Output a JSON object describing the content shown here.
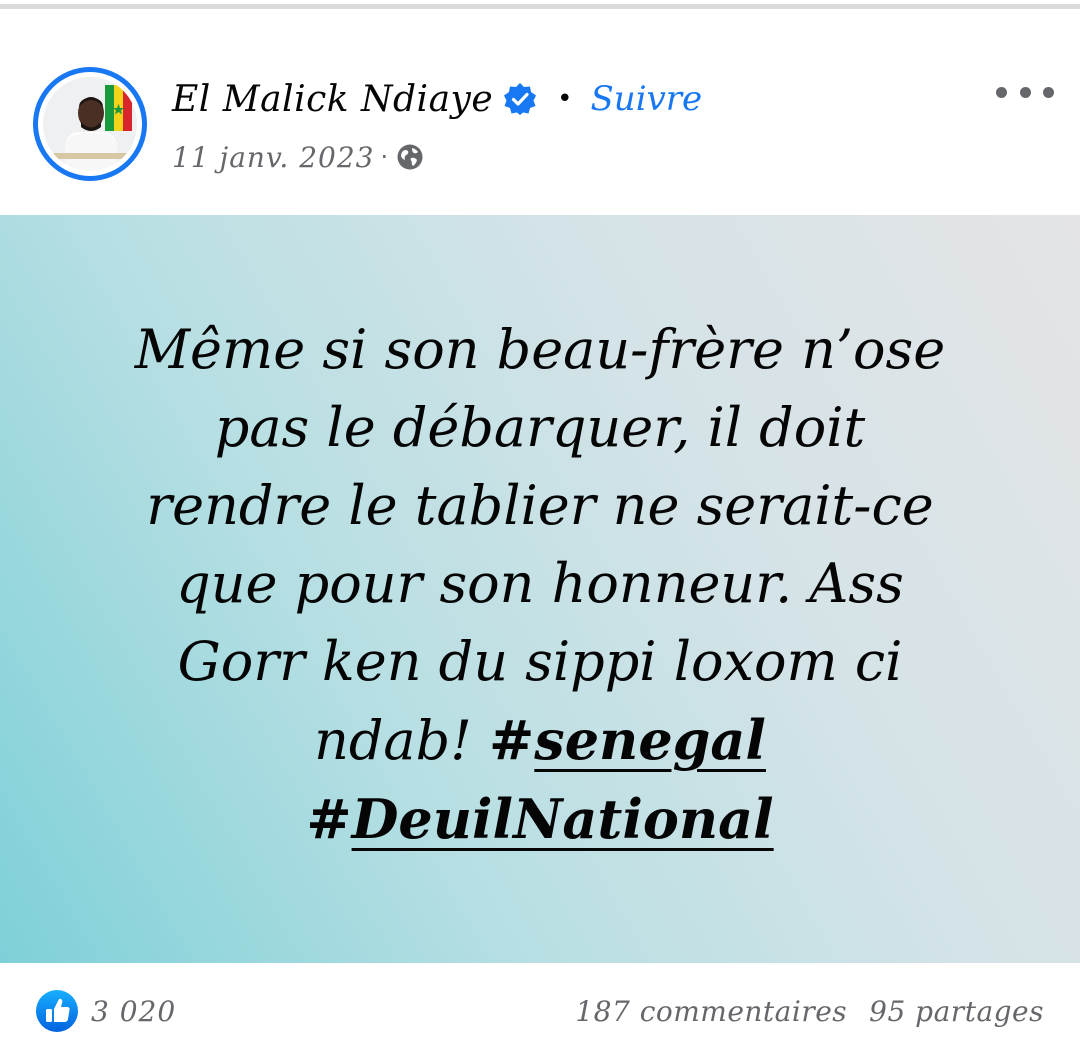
{
  "post": {
    "author": {
      "name": "El Malick Ndiaye",
      "verified_icon": "verified-badge-icon",
      "follow_label": "Suivre",
      "separator": "•"
    },
    "meta": {
      "date": "11 janv. 2023",
      "separator": "·",
      "audience_icon": "globe-icon"
    },
    "menu_icon": "more-options-icon",
    "text_lines": [
      "Même si son beau-frère n’ose",
      "pas le débarquer, il doit",
      "rendre le tablier ne serait-ce",
      "que pour son honneur. Ass",
      "Gorr ken du sippi loxom ci",
      "ndab!"
    ],
    "hashtags": [
      {
        "hash": "#",
        "word": "senegal"
      },
      {
        "hash": "#",
        "word": "DeuilNational"
      }
    ],
    "background_colors": [
      "#7ed0d8",
      "#e4e4e7"
    ]
  },
  "engagement": {
    "like_icon": "like-icon",
    "reaction_count": "3 020",
    "comments": "187 commentaires",
    "shares": "95 partages"
  },
  "colors": {
    "accent": "#1877f2",
    "text": "#050505",
    "muted": "#65676b"
  }
}
